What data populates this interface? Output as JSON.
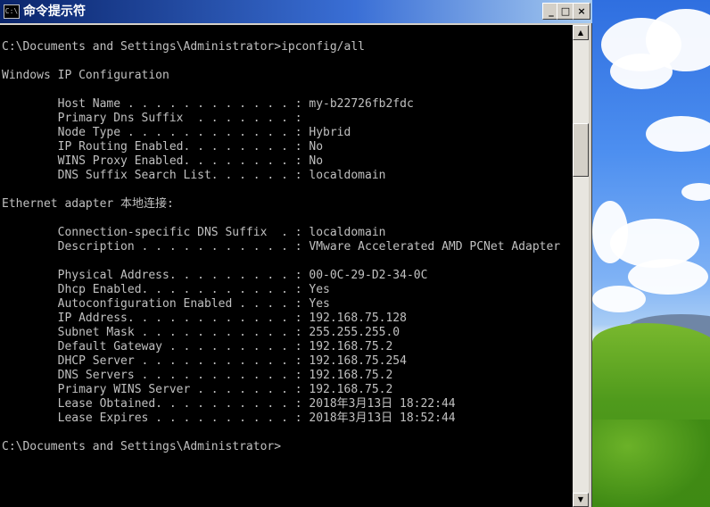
{
  "window": {
    "title": "命令提示符",
    "icon_label": "C:\\",
    "controls": {
      "minimize": "_",
      "maximize": "□",
      "close": "×"
    }
  },
  "console": {
    "lines": [
      "C:\\Documents and Settings\\Administrator>ipconfig/all",
      "",
      "Windows IP Configuration",
      "",
      "        Host Name . . . . . . . . . . . . : my-b22726fb2fdc",
      "        Primary Dns Suffix  . . . . . . . :",
      "        Node Type . . . . . . . . . . . . : Hybrid",
      "        IP Routing Enabled. . . . . . . . : No",
      "        WINS Proxy Enabled. . . . . . . . : No",
      "        DNS Suffix Search List. . . . . . : localdomain",
      "",
      "Ethernet adapter 本地连接:",
      "",
      "        Connection-specific DNS Suffix  . : localdomain",
      "        Description . . . . . . . . . . . : VMware Accelerated AMD PCNet Adapter",
      "",
      "        Physical Address. . . . . . . . . : 00-0C-29-D2-34-0C",
      "        Dhcp Enabled. . . . . . . . . . . : Yes",
      "        Autoconfiguration Enabled . . . . : Yes",
      "        IP Address. . . . . . . . . . . . : 192.168.75.128",
      "        Subnet Mask . . . . . . . . . . . : 255.255.255.0",
      "        Default Gateway . . . . . . . . . : 192.168.75.2",
      "        DHCP Server . . . . . . . . . . . : 192.168.75.254",
      "        DNS Servers . . . . . . . . . . . : 192.168.75.2",
      "        Primary WINS Server . . . . . . . : 192.168.75.2",
      "        Lease Obtained. . . . . . . . . . : 2018年3月13日 18:22:44",
      "        Lease Expires . . . . . . . . . . : 2018年3月13日 18:52:44",
      "",
      "C:\\Documents and Settings\\Administrator>"
    ]
  },
  "scrollbar": {
    "up_arrow": "▲",
    "down_arrow": "▼"
  },
  "colors": {
    "console_bg": "#000000",
    "console_fg": "#c0c0c0",
    "titlebar_start": "#0a246a",
    "titlebar_end": "#a6caf0"
  }
}
